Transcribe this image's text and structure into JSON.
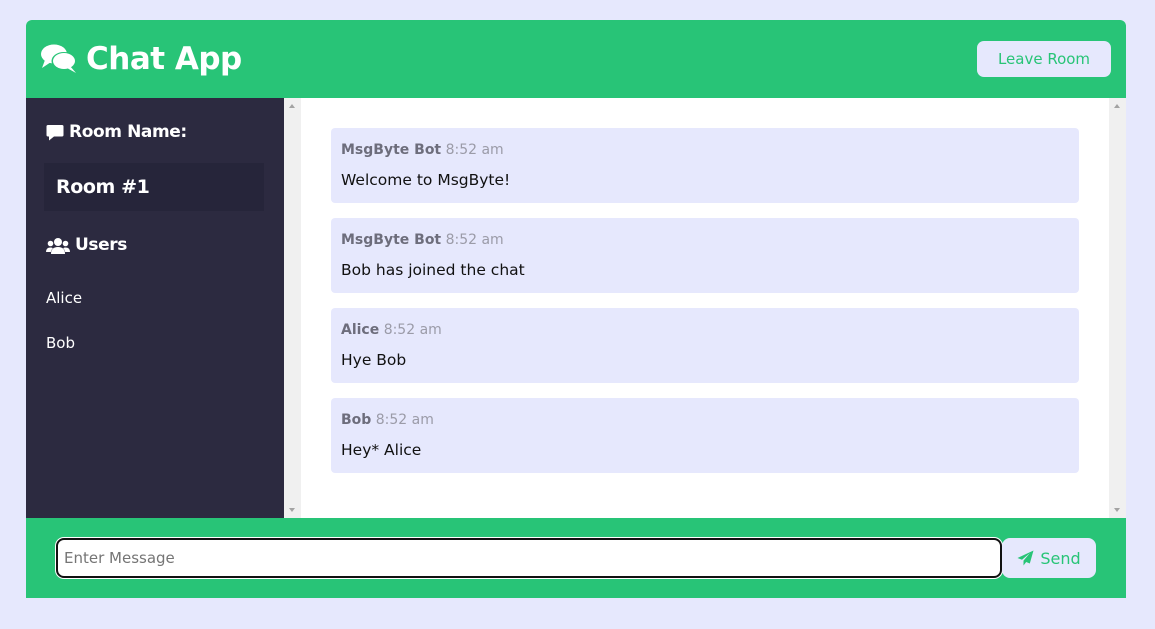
{
  "header": {
    "title": "Chat App",
    "logo_icon": "comments-icon",
    "leave_label": "Leave Room"
  },
  "sidebar": {
    "room_heading": "Room Name:",
    "room_name": "Room #1",
    "users_heading": "Users",
    "users": [
      "Alice",
      "Bob"
    ]
  },
  "messages": [
    {
      "author": "MsgByte Bot",
      "time": "8:52 am",
      "text": "Welcome to MsgByte!"
    },
    {
      "author": "MsgByte Bot",
      "time": "8:52 am",
      "text": "Bob has joined the chat"
    },
    {
      "author": "Alice",
      "time": "8:52 am",
      "text": "Hye Bob"
    },
    {
      "author": "Bob",
      "time": "8:52 am",
      "text": "Hey* Alice"
    }
  ],
  "composer": {
    "placeholder": "Enter Message",
    "value": "",
    "send_label": "Send"
  },
  "colors": {
    "accent": "#28c477",
    "background": "#e6e8fd",
    "sidebar": "#2c2a40",
    "message_bubble": "#e6e8fd"
  }
}
